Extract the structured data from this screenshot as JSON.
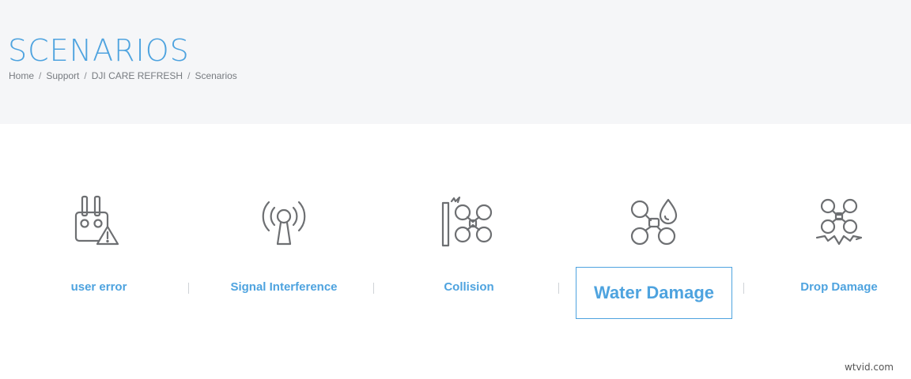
{
  "header": {
    "title": "SCENARIOS",
    "breadcrumb": {
      "items": [
        "Home",
        "Support",
        "DJI CARE REFRESH"
      ],
      "current": "Scenarios",
      "separator": "/"
    }
  },
  "scenarios": [
    {
      "label": "user error",
      "icon": "remote-controller-warning-icon"
    },
    {
      "label": "Signal Interference",
      "icon": "signal-antenna-icon"
    },
    {
      "label": "Collision",
      "icon": "drone-collision-icon"
    },
    {
      "label": "Water Damage",
      "icon": "drone-water-drop-icon",
      "active": true
    },
    {
      "label": "Drop Damage",
      "icon": "drone-crash-icon"
    }
  ],
  "watermark": "wtvid.com",
  "colors": {
    "accent": "#4ea3df",
    "hero_bg": "#f5f6f8",
    "icon_stroke": "#6d6f72",
    "breadcrumb_text": "#777b80"
  }
}
